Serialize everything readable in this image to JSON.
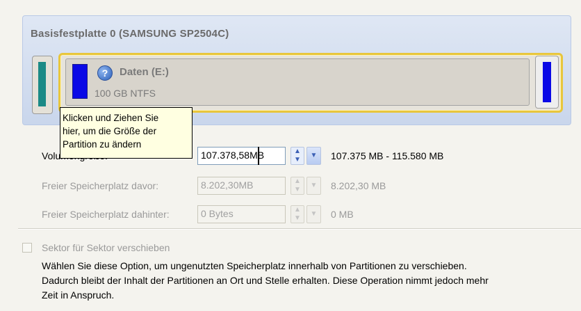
{
  "disk": {
    "title": "Basisfestplatte 0 (SAMSUNG SP2504C)",
    "partition_name": "Daten (E:)",
    "partition_size": "100 GB NTFS",
    "help_glyph": "?"
  },
  "tooltip": {
    "lines": [
      "Klicken und Ziehen Sie",
      "hier, um die Größe der",
      "Partition zu ändern"
    ]
  },
  "fields": [
    {
      "label": "Volumengröße:",
      "value": "107.378,58MB",
      "range": "107.375 MB - 115.580 MB",
      "enabled": true
    },
    {
      "label": "Freier Speicherplatz davor:",
      "value": "8.202,30MB",
      "range": "8.202,30 MB",
      "enabled": false
    },
    {
      "label": "Freier Speicherplatz dahinter:",
      "value": "0 Bytes",
      "range": "0 MB",
      "enabled": false
    }
  ],
  "sector_option": {
    "label": "Sektor für Sektor verschieben",
    "checked": false,
    "enabled": false,
    "description_lines": [
      "Wählen Sie diese Option, um ungenutzten Speicherplatz innerhalb von Partitionen zu verschieben.",
      "Dadurch bleibt der Inhalt der Partitionen an Ort und Stelle erhalten. Diese Operation nimmt jedoch mehr",
      "Zeit in Anspruch."
    ]
  },
  "colors": {
    "primary_partition": "#0a09e6",
    "other_partition": "#1b8a86",
    "selection_border": "#e8c63c",
    "tooltip_bg": "#ffffe1"
  },
  "icons": {
    "spin": "spin-updown-icon",
    "dropdown": "chevron-down-icon",
    "help": "help-icon"
  }
}
